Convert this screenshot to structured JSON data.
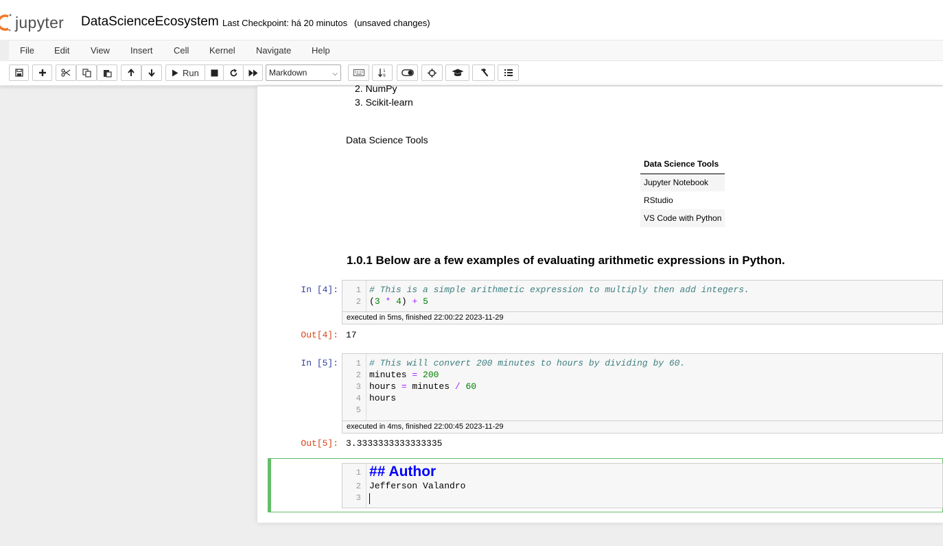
{
  "header": {
    "logo_text": "jupyter",
    "notebook_name": "DataScienceEcosystem",
    "checkpoint": "Last Checkpoint: há 20 minutos",
    "autosave_status": "(unsaved changes)",
    "accent_color": "#f37726"
  },
  "menu": [
    "File",
    "Edit",
    "View",
    "Insert",
    "Cell",
    "Kernel",
    "Navigate",
    "Help"
  ],
  "toolbar": {
    "icons": [
      "save-icon",
      "plus-icon",
      "cut-icon",
      "copy-icon",
      "paste-icon",
      "arrow-up-icon",
      "arrow-down-icon",
      "run-icon",
      "stop-icon",
      "restart-icon",
      "fast-forward-icon",
      "keyboard-icon",
      "sort-icon",
      "toggle-icon",
      "crosshair-icon",
      "graduation-cap-icon",
      "hammer-icon",
      "list-icon"
    ],
    "run_label": "Run",
    "cell_type": "Markdown"
  },
  "notebook": {
    "list_items": [
      "2. NumPy",
      "3. Scikit-learn"
    ],
    "tools_caption": "Data Science Tools",
    "tools_table": {
      "header": "Data Science Tools",
      "rows": [
        "Jupyter Notebook",
        "RStudio",
        "VS Code with Python"
      ]
    },
    "section_heading": "1.0.1  Below are a few examples of evaluating arithmetic expressions in Python.",
    "cells": [
      {
        "in_prompt": "In [4]:",
        "lines": [
          "# This is a simple arithmetic expression to multiply then add integers.",
          "(3 * 4) + 5"
        ],
        "exec_info": "executed in 5ms, finished 22:00:22 2023-11-29",
        "out_prompt": "Out[4]:",
        "output": "17"
      },
      {
        "in_prompt": "In [5]:",
        "lines": [
          "# This will convert 200 minutes to hours by dividing by 60.",
          "minutes = 200",
          "hours = minutes / 60",
          "hours",
          ""
        ],
        "exec_info": "executed in 4ms, finished 22:00:45 2023-11-29",
        "out_prompt": "Out[5]:",
        "output": "3.3333333333333335"
      }
    ],
    "edit_cell": {
      "line1": "## Author",
      "line2": "Jefferson Valandro",
      "line3": ""
    },
    "line_numbers": [
      "1",
      "2",
      "3",
      "4",
      "5"
    ]
  }
}
